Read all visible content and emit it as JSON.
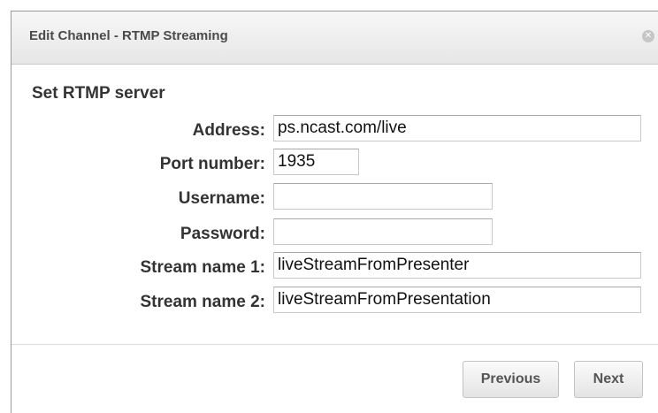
{
  "dialog": {
    "title": "Edit Channel - RTMP Streaming",
    "close_glyph": "✕"
  },
  "form": {
    "section_title": "Set RTMP server",
    "fields": [
      {
        "label": "Address:",
        "value": "ps.ncast.com/live"
      },
      {
        "label": "Port number:",
        "value": "1935"
      },
      {
        "label": "Username:",
        "value": ""
      },
      {
        "label": "Password:",
        "value": ""
      },
      {
        "label": "Stream name 1:",
        "value": "liveStreamFromPresenter"
      },
      {
        "label": "Stream name 2:",
        "value": "liveStreamFromPresentation"
      }
    ]
  },
  "footer": {
    "previous_label": "Previous",
    "next_label": "Next"
  },
  "icons": {
    "close": "close-icon"
  },
  "colors": {
    "title_bar": "#ececec",
    "text": "#333333",
    "border": "#c9c9c9"
  }
}
